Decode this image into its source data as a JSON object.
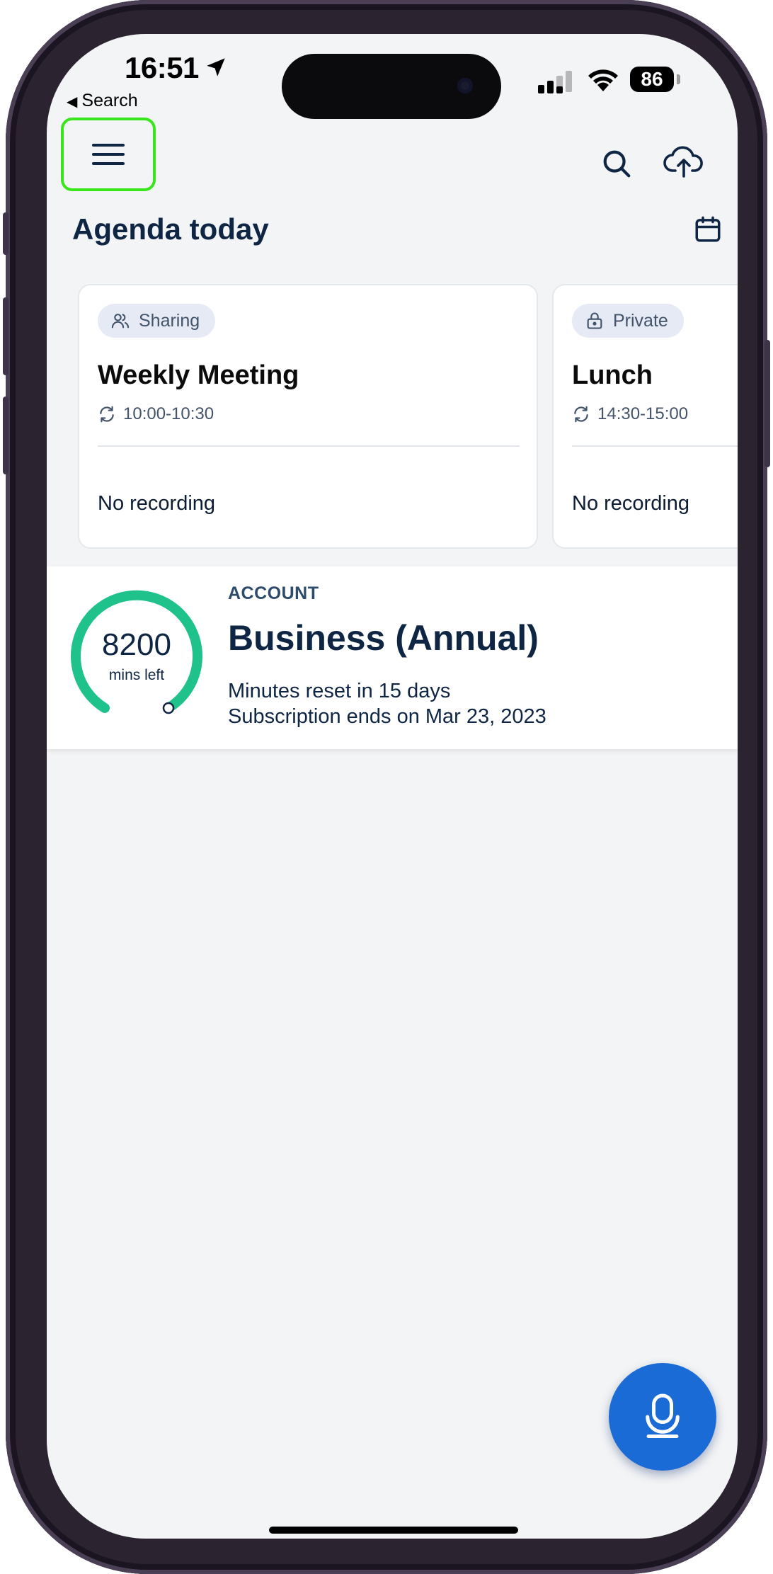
{
  "status_bar": {
    "time": "16:51",
    "back_label": "Search",
    "battery": "86"
  },
  "header": {
    "title": "Agenda today"
  },
  "events": [
    {
      "visibility": "Sharing",
      "title": "Weekly Meeting",
      "time": "10:00-10:30",
      "recording_status": "No recording"
    },
    {
      "visibility": "Private",
      "title": "Lunch",
      "time": "14:30-15:00",
      "recording_status": "No recording"
    }
  ],
  "account": {
    "section_label": "ACCOUNT",
    "minutes_left": "8200",
    "minutes_unit": "mins left",
    "plan": "Business (Annual)",
    "reset_text": "Minutes reset in 15 days",
    "subscription_text": "Subscription ends on Mar 23, 2023"
  },
  "colors": {
    "accent": "#1a6bd6",
    "gauge": "#1fc28a",
    "text_primary": "#0f2544",
    "highlight": "#39e61c"
  },
  "icons": {
    "menu": "hamburger-icon",
    "search": "search-icon",
    "upload": "cloud-upload-icon",
    "calendar": "calendar-icon",
    "sharing": "people-icon",
    "private": "lock-icon",
    "recurring": "repeat-icon",
    "record": "microphone-icon"
  }
}
